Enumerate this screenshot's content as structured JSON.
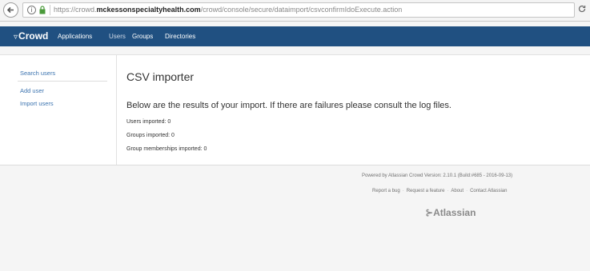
{
  "browser": {
    "url_prefix": "https://crowd.",
    "url_domain": "mckessonspecialtyhealth.com",
    "url_path": "/crowd/console/secure/dataimport/csvconfirmIdoExecute.action"
  },
  "topnav": {
    "logo": "Crowd",
    "items": [
      "Applications",
      "Users",
      "Groups",
      "Directories"
    ]
  },
  "sidebar": {
    "items": [
      "Search users",
      "Add user",
      "Import users"
    ]
  },
  "main": {
    "title": "CSV importer",
    "message": "Below are the results of your import. If there are failures please consult the log files.",
    "stats": [
      "Users imported: 0",
      "Groups imported: 0",
      "Group memberships imported: 0"
    ]
  },
  "footer": {
    "powered_by": "Powered by Atlassian Crowd Version: 2.10.1 (Build:#685 - 2016-09-13)",
    "links": [
      "Report a bug",
      "Request a feature",
      "About",
      "Contact Atlassian"
    ],
    "logo": "Atlassian"
  },
  "colors": {
    "nav_bg": "#205081",
    "link": "#3b73af"
  }
}
